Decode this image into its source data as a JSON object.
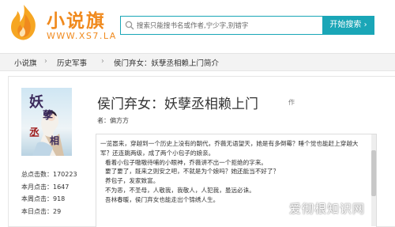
{
  "site": {
    "logo_text": "小说旗",
    "logo_url": "WWW.XS7.LA"
  },
  "search": {
    "placeholder": "搜索只能搜书名或作者,宁少字,别错字",
    "button_label": "开始搜索 ›"
  },
  "breadcrumb": [
    {
      "label": "小说旗"
    },
    {
      "label": "历史军事"
    },
    {
      "label": "侯门弃女：妖孽丞相赖上门简介"
    }
  ],
  "book": {
    "title": "侯门弃女：妖孽丞相赖上门",
    "title_suffix": "作",
    "author": "者：偏方方",
    "cover_text": [
      "妖",
      "孽",
      "丞",
      "相"
    ],
    "stats": [
      {
        "label": "总点击数：170223"
      },
      {
        "label": "本月点击：1647"
      },
      {
        "label": "本周点击：918"
      },
      {
        "label": "本日点击：29"
      }
    ],
    "intro_lines": [
      "一览嚣来，穿越到一个历史上没有的朝代，乔薇无语望天，她是有多倒霉？睡个觉也能赶上穿越大",
      "军？还连跳两级，成了两个小包子的娘亲。",
      "看着小包子嗷嗷待哺的小眼神，乔薇讲不出一个拒绝的字来。",
      "要了要了，既来之则安之吧，不就是为个娘吗？她还能当不好了？",
      "养包子，发家致富。",
      "不为恶，不圣母，人敬我，我敬人，人犯我，虽远必诛。",
      "吾林春暖，侯门弃女也能走出个锦绣人生。"
    ]
  },
  "watermark": "爱彻根知识网",
  "colors": {
    "brand_orange": "#f08a1e",
    "search_teal": "#1aa6b7"
  }
}
